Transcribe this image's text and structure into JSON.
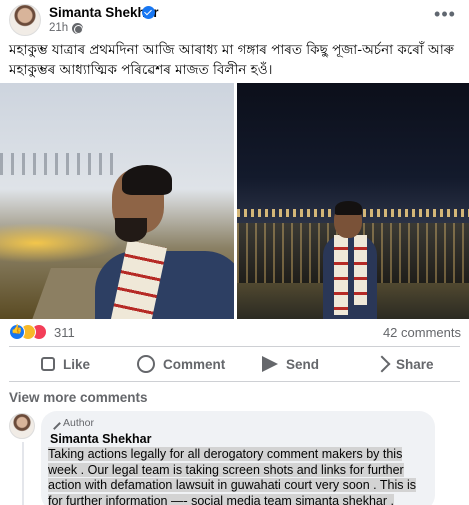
{
  "post": {
    "author": "Simanta Shekhar",
    "time": "21h ·",
    "text": "মহাকুম্ভ যাত্ৰাৰ প্ৰথমদিনা আজি আৰাধ্য মা গঙ্গাৰ পাৰত কিছু পূজা-অৰ্চনা কৰোঁ আৰু মহাকুম্ভৰ আধ্যাত্মিক পৰিৱেশৰ মাজত বিলীন হওঁ।"
  },
  "icons": {
    "verified": "verified-badge-icon",
    "privacy": "globe-icon",
    "more": "more-options-icon"
  },
  "stats": {
    "reaction_count": "311",
    "comment_count": "42 comments"
  },
  "actions": {
    "like": "Like",
    "comment": "Comment",
    "send": "Send",
    "share": "Share"
  },
  "comments": {
    "view_more": "View more comments",
    "top": {
      "badge": "Author",
      "author": "Simanta Shekhar",
      "text": "Taking actions legally for all derogatory comment makers by this week . Our legal team is taking screen shots and links for further action with defamation lawsuit in guwahati court very soon . This is for further information —- social media team simanta shekhar ."
    }
  },
  "colors": {
    "brand_blue": "#1877f2",
    "secondary_text": "#65676b",
    "bubble_bg": "#f0f2f5"
  }
}
